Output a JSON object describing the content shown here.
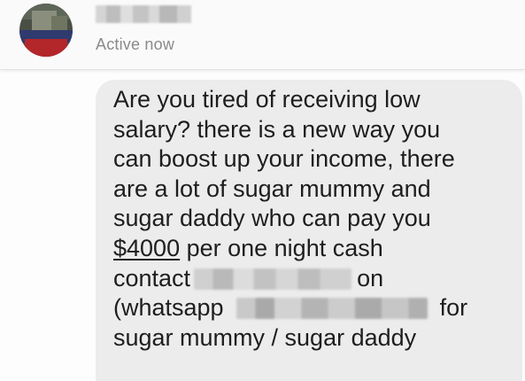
{
  "header": {
    "status": "Active now",
    "name_redacted": true
  },
  "message": {
    "line1": "Are you tired of receiving low",
    "line2": "salary? there is a new way you",
    "line3": "can boost up your income, there",
    "line4": "are a lot of sugar mummy and",
    "line5": "sugar daddy who can pay you",
    "line6_amount": "$4000",
    "line6_rest": " per one night cash",
    "line7_start": "contact",
    "line7_end": "on",
    "line8_start": "(whatsapp",
    "line8_end": "for",
    "line9": "sugar mummy / sugar daddy"
  },
  "colors": {
    "bubble": "#ececec",
    "status_text": "#8a8a8a",
    "message_text": "#1e1e1e"
  }
}
